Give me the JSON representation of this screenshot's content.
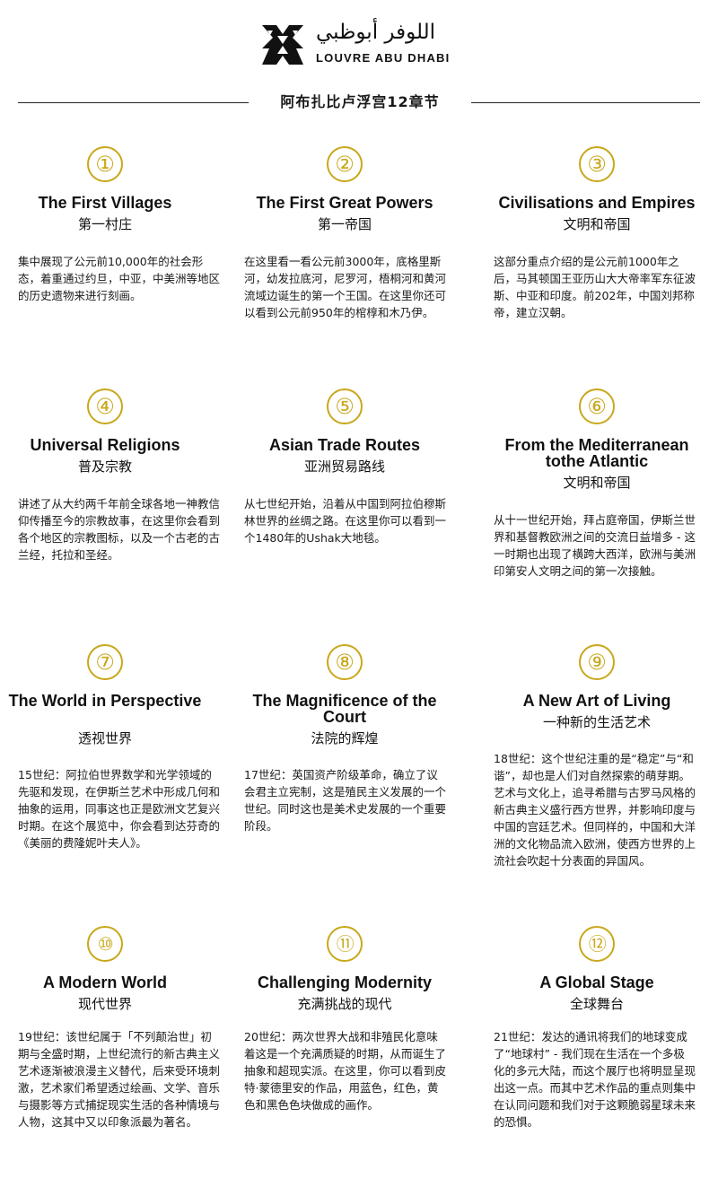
{
  "header": {
    "logo_arabic": "اللوفر أبوظبي",
    "logo_latin": "LOUVRE ABU DHABI",
    "subtitle": "阿布扎比卢浮宫12章节"
  },
  "chapters": [
    {
      "number": "①",
      "title": "The First Villages",
      "subtitle": "第一村庄",
      "desc": "集中展现了公元前10,000年的社会形态，着重通过约旦，中亚，中美洲等地区的历史遗物来进行刻画。"
    },
    {
      "number": "②",
      "title": "The First Great Powers",
      "subtitle": "第一帝国",
      "desc": "在这里看一看公元前3000年，底格里斯河，幼发拉底河，尼罗河，梧桐河和黄河流域边诞生的第一个王国。在这里你还可以看到公元前950年的棺椁和木乃伊。"
    },
    {
      "number": "③",
      "title": "Civilisations and Empires",
      "subtitle": "文明和帝国",
      "desc": "这部分重点介绍的是公元前1000年之后，马其顿国王亚历山大大帝率军东征波斯、中亚和印度。前202年，中国刘邦称帝，建立汉朝。"
    },
    {
      "number": "④",
      "title": "Universal Religions",
      "subtitle": "普及宗教",
      "desc": "讲述了从大约两千年前全球各地一神教信仰传播至今的宗教故事，在这里你会看到各个地区的宗教图标，以及一个古老的古兰经，托拉和圣经。"
    },
    {
      "number": "⑤",
      "title": "Asian Trade Routes",
      "subtitle": "亚洲贸易路线",
      "desc": "从七世纪开始，沿着从中国到阿拉伯穆斯林世界的丝绸之路。在这里你可以看到一个1480年的Ushak大地毯。"
    },
    {
      "number": "⑥",
      "title": "From the Mediterranean tothe Atlantic",
      "subtitle": "文明和帝国",
      "desc": "从十一世纪开始，拜占庭帝国，伊斯兰世界和基督教欧洲之间的交流日益增多 - 这一时期也出现了横跨大西洋，欧洲与美洲印第安人文明之间的第一次接触。"
    },
    {
      "number": "⑦",
      "title": "The World in Perspective",
      "subtitle": "透视世界",
      "desc": "15世纪：阿拉伯世界数学和光学领域的先驱和发现，在伊斯兰艺术中形成几何和抽象的运用，同事这也正是欧洲文艺复兴时期。在这个展览中，你会看到达芬奇的《美丽的费隆妮叶夫人》。"
    },
    {
      "number": "⑧",
      "title": "The Magnificence of the Court",
      "subtitle": "法院的辉煌",
      "desc": "17世纪：英国资产阶级革命，确立了议会君主立宪制，这是殖民主义发展的一个世纪。同时这也是美术史发展的一个重要阶段。"
    },
    {
      "number": "⑨",
      "title": "A New Art of Living",
      "subtitle": "一种新的生活艺术",
      "desc": "18世纪：这个世纪注重的是“稳定”与“和谐”，却也是人们对自然探索的萌芽期。艺术与文化上，追寻希腊与古罗马风格的新古典主义盛行西方世界，并影响印度与中国的宫廷艺术。但同样的，中国和大洋洲的文化物品流入欧洲，使西方世界的上流社会吹起十分表面的异国风。"
    },
    {
      "number": "⑩",
      "title": "A Modern World",
      "subtitle": "现代世界",
      "desc": "19世纪：该世纪属于「不列颠治世」初期与全盛时期，上世纪流行的新古典主义艺术逐渐被浪漫主义替代，后来受环境刺激，艺术家们希望透过绘画、文学、音乐与摄影等方式捕捉现实生活的各种情境与人物，这其中又以印象派最为著名。"
    },
    {
      "number": "⑪",
      "title": "Challenging Modernity",
      "subtitle": "充满挑战的现代",
      "desc": "20世纪：两次世界大战和非殖民化意味着这是一个充满质疑的时期，从而诞生了抽象和超现实派。在这里，你可以看到皮特·蒙德里安的作品，用蓝色，红色，黄色和黑色色块做成的画作。"
    },
    {
      "number": "⑫",
      "title": "A Global Stage",
      "subtitle": "全球舞台",
      "desc": "21世纪：发达的通讯将我们的地球变成了“地球村” - 我们现在生活在一个多极化的多元大陆，而这个展厅也将明显呈现出这一点。而其中艺术作品的重点则集中在认同问题和我们对于这颗脆弱星球未来的恐惧。"
    }
  ],
  "colors": {
    "accent": "#c9a71b",
    "text": "#1a1a1a",
    "background": "#ffffff"
  }
}
